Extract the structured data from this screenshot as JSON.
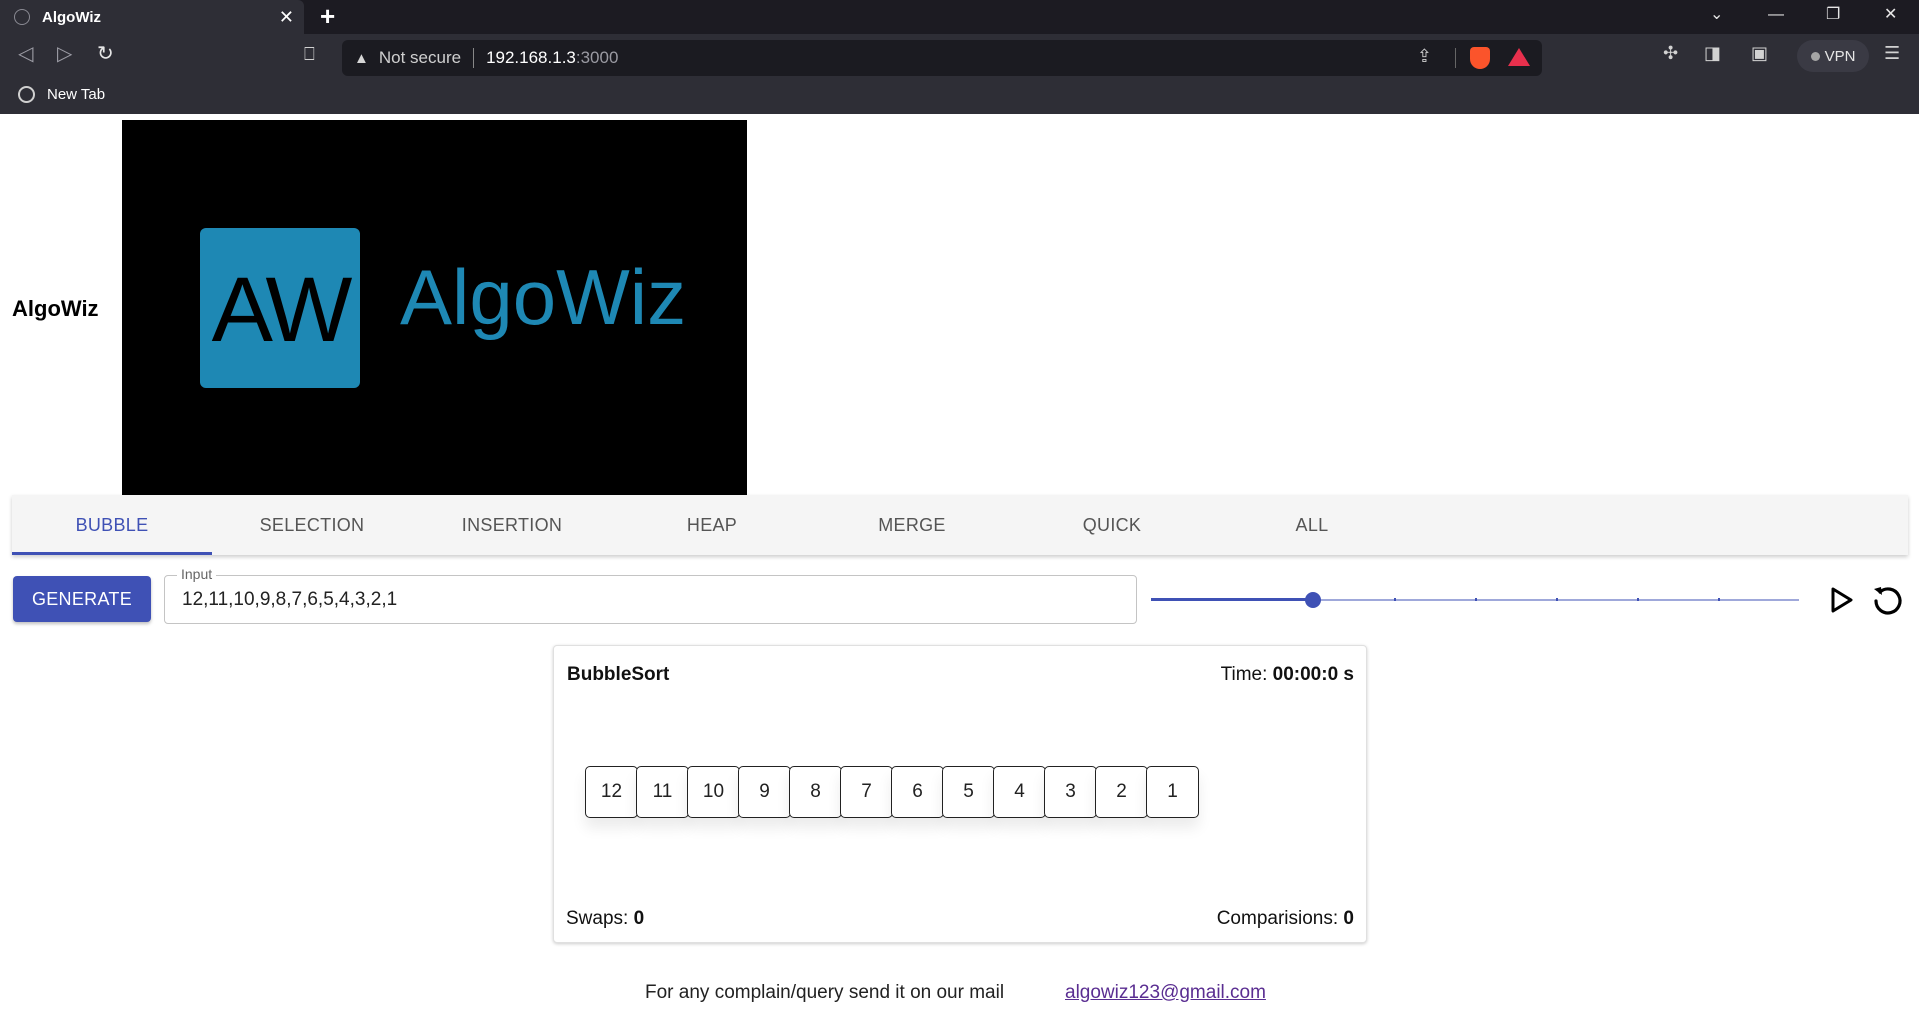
{
  "browser": {
    "tab_title": "AlgoWiz",
    "tab_close": "✕",
    "new_tab": "+",
    "url_warning": "Not secure",
    "url_host": "192.168.1.3",
    "url_port": ":3000",
    "vpn_label": "VPN",
    "bookmark_label": "New Tab"
  },
  "brand": {
    "name": "AlgoWiz",
    "logo_mark": "AW",
    "logo_word": "AlgoWiz",
    "logo_color": "#1e88b4"
  },
  "tabs": [
    {
      "label": "BUBBLE",
      "active": true
    },
    {
      "label": "SELECTION",
      "active": false
    },
    {
      "label": "INSERTION",
      "active": false
    },
    {
      "label": "HEAP",
      "active": false
    },
    {
      "label": "MERGE",
      "active": false
    },
    {
      "label": "QUICK",
      "active": false
    },
    {
      "label": "ALL",
      "active": false
    }
  ],
  "controls": {
    "generate_label": "GENERATE",
    "input_label": "Input",
    "input_value": "12,11,10,9,8,7,6,5,4,3,2,1",
    "speed_steps": 9,
    "speed_value_step": 2,
    "accent": "#3f51b5"
  },
  "card": {
    "title": "BubbleSort",
    "time_label": "Time: ",
    "time_value": "00:00:0 s",
    "array": [
      "12",
      "11",
      "10",
      "9",
      "8",
      "7",
      "6",
      "5",
      "4",
      "3",
      "2",
      "1"
    ],
    "swaps_label": "Swaps: ",
    "swaps_value": "0",
    "comparisons_label": "Comparisions: ",
    "comparisons_value": "0"
  },
  "footer": {
    "text": "For any complain/query send it on our mail",
    "email": "algowiz123@gmail.com"
  }
}
